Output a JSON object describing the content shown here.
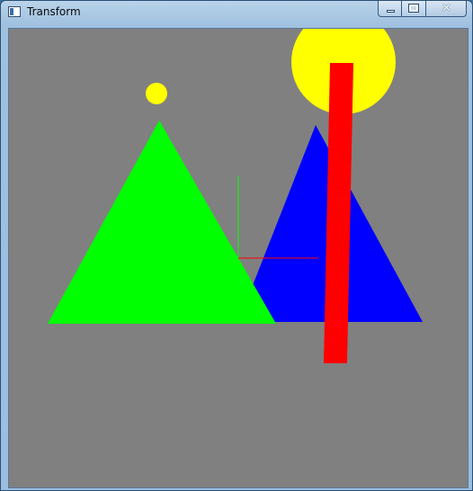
{
  "window": {
    "title": "Transform",
    "controls": {
      "minimize": "minimize",
      "maximize": "maximize",
      "close": "close"
    }
  },
  "scene": {
    "background_color": "#808080",
    "shapes": [
      {
        "name": "green-triangle",
        "kind": "triangle",
        "color": "#00ff00"
      },
      {
        "name": "blue-triangle",
        "kind": "triangle",
        "color": "#0000ff"
      },
      {
        "name": "small-yellow-circle",
        "kind": "circle",
        "color": "#ffff00"
      },
      {
        "name": "large-yellow-circle",
        "kind": "circle",
        "color": "#ffff00"
      },
      {
        "name": "red-bar",
        "kind": "quad",
        "color": "#ff0000"
      }
    ],
    "axes": {
      "x_axis_color": "#ff0000",
      "y_axis_color": "#00ff00"
    }
  }
}
